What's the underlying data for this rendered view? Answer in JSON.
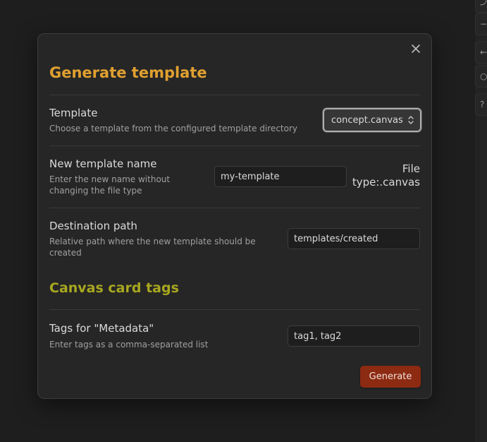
{
  "modal": {
    "title": "Generate template",
    "template": {
      "name": "Template",
      "desc": "Choose a template from the configured template directory",
      "selected": "concept.canvas"
    },
    "new_name": {
      "name": "New template name",
      "desc_line1": "Enter the new name without",
      "desc_line2": "changing the file type",
      "value": "my-template",
      "filetype_line1": "File",
      "filetype_line2": "type:.canvas"
    },
    "destination": {
      "name": "Destination path",
      "desc_line1": "Relative path where the new template should be",
      "desc_line2": "created",
      "value": "templates/created"
    },
    "section": "Canvas card tags",
    "tags": {
      "name": "Tags for \"Metadata\"",
      "desc": "Enter tags as a comma-separated list",
      "value": "tag1, tag2"
    },
    "generate_label": "Generate"
  }
}
